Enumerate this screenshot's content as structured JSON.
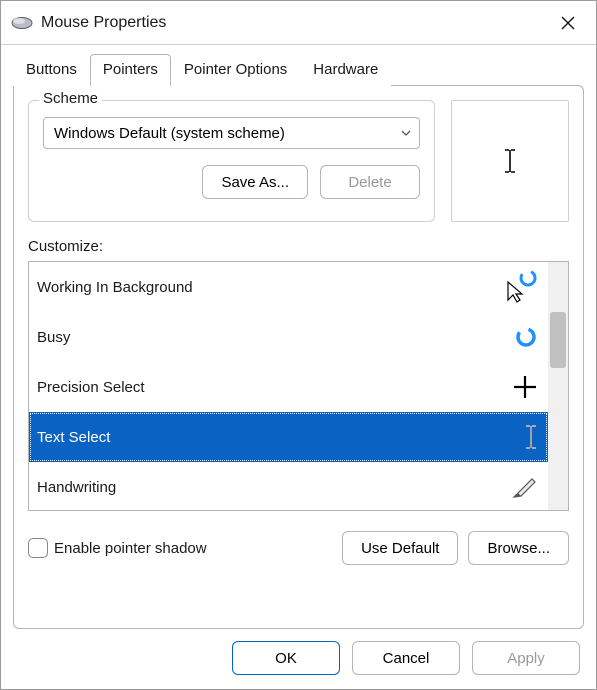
{
  "window": {
    "title": "Mouse Properties"
  },
  "tabs": {
    "buttons": "Buttons",
    "pointers": "Pointers",
    "pointer_options": "Pointer Options",
    "hardware": "Hardware",
    "active": "pointers"
  },
  "scheme": {
    "legend": "Scheme",
    "selected": "Windows Default (system scheme)",
    "save_as_label": "Save As...",
    "delete_label": "Delete"
  },
  "preview": {
    "cursor": "text-select"
  },
  "customize": {
    "label": "Customize:",
    "items": [
      {
        "label": "Working In Background",
        "cursor": "arrow-busy",
        "selected": false
      },
      {
        "label": "Busy",
        "cursor": "busy",
        "selected": false
      },
      {
        "label": "Precision Select",
        "cursor": "cross",
        "selected": false
      },
      {
        "label": "Text Select",
        "cursor": "ibeam",
        "selected": true
      },
      {
        "label": "Handwriting",
        "cursor": "pen",
        "selected": false
      }
    ],
    "selected_index": 3
  },
  "shadow": {
    "label": "Enable pointer shadow",
    "checked": false
  },
  "actions": {
    "use_default": "Use Default",
    "browse": "Browse..."
  },
  "dialog_buttons": {
    "ok": "OK",
    "cancel": "Cancel",
    "apply": "Apply"
  }
}
